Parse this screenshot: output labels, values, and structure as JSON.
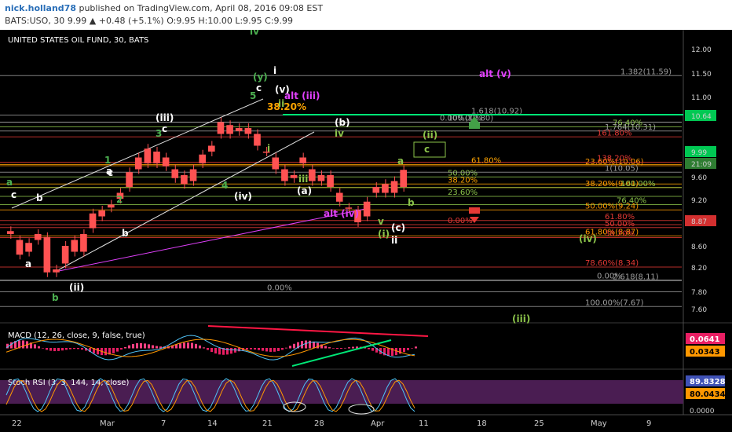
{
  "header": {
    "author": "nick.holland78",
    "published_text": " published on TradingView.com, April 08, 2016 09:08 EST",
    "quote_text": "BATS:USO, 30  9.99 ▲ +0.48 (+5.1%) O:9.95 H:10.00 L:9.95 C:9.99"
  },
  "chart_data": {
    "type": "candlestick",
    "title": "UNITED STATES OIL FUND, 30, BATS",
    "price_axis_ticks": [
      "12.00",
      "11.50",
      "11.00",
      "10.64",
      "9.99",
      "21:09",
      "9.60",
      "9.20",
      "8.87",
      "8.60",
      "8.20",
      "7.80",
      "7.60"
    ],
    "date_axis_ticks": [
      "22",
      "Mar",
      "7",
      "14",
      "21",
      "28",
      "Apr",
      "11",
      "18",
      "25",
      "May",
      "9"
    ],
    "ylim": [
      7.5,
      12.1
    ],
    "price_path": [
      [
        8.95,
        8.9
      ],
      [
        8.8,
        8.55
      ],
      [
        8.6,
        8.75
      ],
      [
        8.8,
        8.9
      ],
      [
        8.85,
        8.25
      ],
      [
        8.3,
        8.25
      ],
      [
        8.4,
        8.7
      ],
      [
        8.8,
        8.6
      ],
      [
        8.6,
        8.9
      ],
      [
        9.0,
        9.25
      ],
      [
        9.2,
        9.3
      ],
      [
        9.4,
        9.35
      ],
      [
        9.5,
        9.6
      ],
      [
        9.7,
        9.95
      ],
      [
        10.0,
        10.2
      ],
      [
        10.1,
        10.35
      ],
      [
        10.3,
        10.1
      ],
      [
        10.2,
        10.05
      ],
      [
        10.0,
        9.85
      ],
      [
        9.9,
        9.75
      ],
      [
        9.8,
        10.0
      ],
      [
        10.1,
        10.25
      ],
      [
        10.3,
        10.4
      ],
      [
        10.6,
        10.8
      ],
      [
        10.75,
        10.6
      ],
      [
        10.7,
        10.65
      ],
      [
        10.7,
        10.6
      ],
      [
        10.6,
        10.4
      ],
      [
        10.3,
        10.3
      ],
      [
        10.2,
        10.0
      ],
      [
        10.0,
        9.8
      ],
      [
        9.85,
        9.9
      ],
      [
        10.2,
        10.1
      ],
      [
        10.0,
        9.8
      ],
      [
        9.8,
        9.9
      ],
      [
        9.9,
        9.7
      ],
      [
        9.6,
        9.45
      ],
      [
        9.35,
        9.35
      ],
      [
        9.3,
        9.1
      ],
      [
        9.2,
        9.45
      ],
      [
        9.6,
        9.7
      ],
      [
        9.75,
        9.6
      ],
      [
        9.6,
        9.8
      ],
      [
        9.7,
        9.99
      ]
    ],
    "price_labels": {
      "current": "9.99",
      "level_1064": "10.64",
      "level_887": "8.87",
      "other": "21:09"
    },
    "horizontal_lines": [
      {
        "label": "1.382(11.59)",
        "price": 11.59,
        "color": "#9e9e9e"
      },
      {
        "label": "1.618(10.92)",
        "price": 10.92,
        "color": "#9e9e9e"
      },
      {
        "label": "0.00%(10.80)",
        "price": 10.8,
        "color": "#9e9e9e"
      },
      {
        "label": "100.00%",
        "price": 10.8,
        "color": "#9e9e9e"
      },
      {
        "label": "76.40%",
        "price": 10.72,
        "color": "#8bc34a"
      },
      {
        "label": "1.764(10.31)",
        "price": 10.65,
        "color": "#9e9e9e"
      },
      {
        "label": "161.80%",
        "price": 10.55,
        "color": "#e53935"
      },
      {
        "label": "23.60%(10.06)",
        "price": 10.06,
        "color": "#ff9800"
      },
      {
        "label": "138.20%",
        "price": 10.12,
        "color": "#e53935"
      },
      {
        "label": "61.80%",
        "price": 10.08,
        "color": "#ffa500"
      },
      {
        "label": "50.00%",
        "price": 9.87,
        "color": "#8bc34a"
      },
      {
        "label": "1(10.05)",
        "price": 9.95,
        "color": "#9e9e9e"
      },
      {
        "label": "38.20%(9.61)",
        "price": 9.69,
        "color": "#ff9800"
      },
      {
        "label": "38.20%",
        "price": 9.75,
        "color": "#ffa500"
      },
      {
        "label": "100.00%",
        "price": 9.69,
        "color": "#8bc34a"
      },
      {
        "label": "23.60%",
        "price": 9.54,
        "color": "#8bc34a"
      },
      {
        "label": "76.40%",
        "price": 9.4,
        "color": "#8bc34a"
      },
      {
        "label": "50.00%(9.24)",
        "price": 9.31,
        "color": "#ff9800"
      },
      {
        "label": "61.80%",
        "price": 9.13,
        "color": "#e53935"
      },
      {
        "label": "0.00%",
        "price": 9.06,
        "color": "#e53935"
      },
      {
        "label": "50.00%",
        "price": 9.01,
        "color": "#e53935"
      },
      {
        "label": "61.80%(8.87)",
        "price": 8.87,
        "color": "#ff9800"
      },
      {
        "label": "38.20%",
        "price": 8.84,
        "color": "#e53935"
      },
      {
        "label": "78.60%(8.34)",
        "price": 8.34,
        "color": "#e53935"
      },
      {
        "label": "0.00%",
        "price": 8.12,
        "color": "#9e9e9e"
      },
      {
        "label": "2.618(8.11)",
        "price": 8.11,
        "color": "#9e9e9e"
      },
      {
        "label": "0.00%",
        "price": 7.92,
        "color": "#9e9e9e"
      },
      {
        "label": "100.00%(7.67)",
        "price": 7.67,
        "color": "#9e9e9e"
      }
    ],
    "wave_labels": [
      {
        "text": "a",
        "color": "#4caf50"
      },
      {
        "text": "c",
        "color": "#ffffff"
      },
      {
        "text": "b",
        "color": "#ffffff"
      },
      {
        "text": "a",
        "color": "#ffffff"
      },
      {
        "text": "c",
        "color": "#ffffff"
      },
      {
        "text": "(ii)",
        "color": "#ffffff"
      },
      {
        "text": "b",
        "color": "#4caf50"
      },
      {
        "text": "a",
        "color": "#ffffff"
      },
      {
        "text": "1",
        "color": "#4caf50"
      },
      {
        "text": "2",
        "color": "#4caf50"
      },
      {
        "text": "b",
        "color": "#ffffff"
      },
      {
        "text": "3",
        "color": "#4caf50"
      },
      {
        "text": "(iii)",
        "color": "#ffffff"
      },
      {
        "text": "c",
        "color": "#ffffff"
      },
      {
        "text": "4",
        "color": "#4caf50"
      },
      {
        "text": "(iv)",
        "color": "#ffffff"
      },
      {
        "text": "iv",
        "color": "#4caf50"
      },
      {
        "text": "(y)",
        "color": "#4caf50"
      },
      {
        "text": "c",
        "color": "#ffffff"
      },
      {
        "text": "5",
        "color": "#4caf50"
      },
      {
        "text": "i",
        "color": "#ffffff"
      },
      {
        "text": "(v)",
        "color": "#ffffff"
      },
      {
        "text": "alt (iii)",
        "color": "#e040fb"
      },
      {
        "text": "38.20%",
        "color": "#ffa500"
      },
      {
        "text": "ii",
        "color": "#8bc34a"
      },
      {
        "text": "i",
        "color": "#8bc34a"
      },
      {
        "text": "(b)",
        "color": "#ffffff"
      },
      {
        "text": "iv",
        "color": "#8bc34a"
      },
      {
        "text": "iii",
        "color": "#8bc34a"
      },
      {
        "text": "(a)",
        "color": "#ffffff"
      },
      {
        "text": "alt (iv)",
        "color": "#e040fb"
      },
      {
        "text": "v",
        "color": "#8bc34a"
      },
      {
        "text": "(i)",
        "color": "#8bc34a"
      },
      {
        "text": "(c)",
        "color": "#ffffff"
      },
      {
        "text": "ii",
        "color": "#ffffff"
      },
      {
        "text": "a",
        "color": "#8bc34a"
      },
      {
        "text": "b",
        "color": "#8bc34a"
      },
      {
        "text": "(ii)",
        "color": "#8bc34a"
      },
      {
        "text": "c",
        "color": "#8bc34a"
      },
      {
        "text": "alt (v)",
        "color": "#e040fb"
      },
      {
        "text": "(iv)",
        "color": "#8bc34a"
      },
      {
        "text": "(iii)",
        "color": "#8bc34a"
      }
    ],
    "macd": {
      "title": "MACD (12, 26, close, 9, false, true)",
      "value_1": "0.0641",
      "value_2": "0.0343"
    },
    "stoch_rsi": {
      "title": "Stoch RSI (3, 3, 144, 14, close)",
      "value_1": "89.8328",
      "value_2": "80.0434",
      "ticks": [
        "0.0000"
      ]
    }
  }
}
